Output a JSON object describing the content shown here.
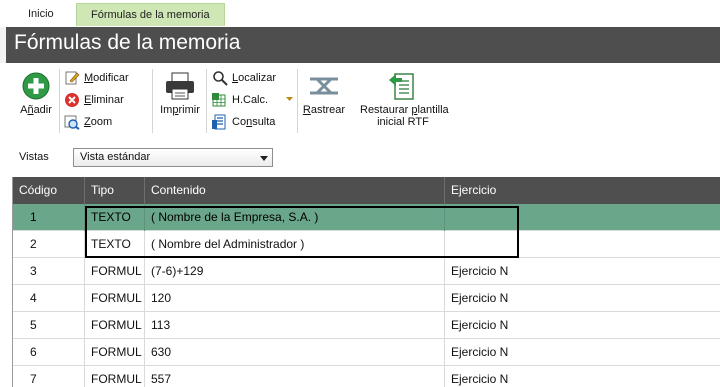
{
  "tabs": [
    {
      "label": "Inicio",
      "active": false
    },
    {
      "label": "Fórmulas de la memoria",
      "active": true
    }
  ],
  "header": {
    "title": "Fórmulas de la memoria"
  },
  "toolbar": {
    "anadir": {
      "prefix": "A",
      "underlined": "ñ",
      "suffix": "adir",
      "icon": "add-icon"
    },
    "modificar": {
      "underlined": "M",
      "suffix": "odificar",
      "icon": "edit-icon"
    },
    "eliminar": {
      "underlined": "E",
      "suffix": "liminar",
      "icon": "delete-icon"
    },
    "zoom": {
      "underlined": "Z",
      "suffix": "oom",
      "icon": "zoom-icon"
    },
    "imprimir": {
      "prefix": "Im",
      "underlined": "p",
      "suffix": "rimir",
      "icon": "printer-icon"
    },
    "localizar": {
      "underlined": "L",
      "suffix": "ocalizar",
      "icon": "search-icon"
    },
    "hcalc": {
      "label": "H.Calc.",
      "icon": "spreadsheet-icon"
    },
    "consulta": {
      "prefix": "Co",
      "underlined": "n",
      "suffix": "sulta",
      "icon": "query-icon"
    },
    "rastrear": {
      "underlined": "R",
      "suffix": "astrear",
      "icon": "trace-icon"
    },
    "restaurar": {
      "line1_prefix": "Restaurar ",
      "line1_underlined": "p",
      "line1_suffix": "lantilla",
      "line2": "inicial RTF",
      "icon": "restore-template-icon"
    }
  },
  "vistas": {
    "label": "Vistas",
    "selected": "Vista estándar"
  },
  "grid": {
    "columns": {
      "codigo": "Código",
      "tipo": "Tipo",
      "contenido": "Contenido",
      "ejercicio": "Ejercicio"
    },
    "rows": [
      {
        "codigo": "1",
        "tipo": "TEXTO",
        "contenido": "( Nombre de la Empresa, S.A. )",
        "ejercicio": "",
        "selected": true
      },
      {
        "codigo": "2",
        "tipo": "TEXTO",
        "contenido": "( Nombre del Administrador )",
        "ejercicio": "",
        "selected": false
      },
      {
        "codigo": "3",
        "tipo": "FORMUL",
        "contenido": "(7-6)+129",
        "ejercicio": "Ejercicio N",
        "selected": false
      },
      {
        "codigo": "4",
        "tipo": "FORMUL",
        "contenido": "120",
        "ejercicio": "Ejercicio N",
        "selected": false
      },
      {
        "codigo": "5",
        "tipo": "FORMUL",
        "contenido": "113",
        "ejercicio": "Ejercicio N",
        "selected": false
      },
      {
        "codigo": "6",
        "tipo": "FORMUL",
        "contenido": "630",
        "ejercicio": "Ejercicio N",
        "selected": false
      },
      {
        "codigo": "7",
        "tipo": "FORMUL",
        "contenido": "557",
        "ejercicio": "Ejercicio N",
        "selected": false
      }
    ]
  },
  "colors": {
    "header_bg": "#4e4e4e",
    "active_tab": "#cfe6b5",
    "selected_row": "#6aa68a",
    "grid_header": "#4f4f4f"
  }
}
